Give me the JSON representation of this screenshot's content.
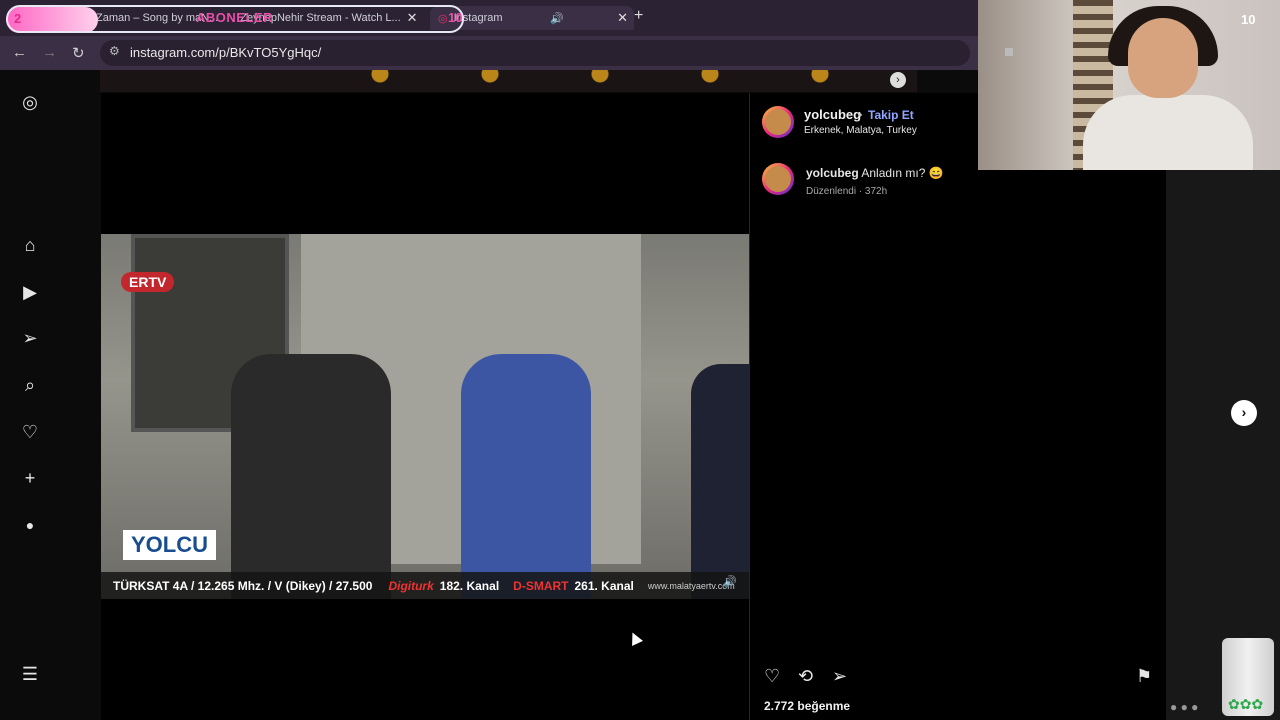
{
  "browser": {
    "tabs": [
      {
        "label": "Zaman – Song by maN..."
      },
      {
        "label": "ZeynepNehir Stream - Watch L..."
      },
      {
        "label": "Instagram"
      }
    ],
    "url": "instagram.com/p/BKvTO5YgHqc/"
  },
  "stream_overlay": {
    "counter_left": "2",
    "title": "ABONELER",
    "counter_right": "10",
    "webcam_badge": "10"
  },
  "video": {
    "logo_top": "ERTV",
    "logo_bottom": "YOLCU",
    "ticker": {
      "satellite": "TÜRKSAT 4A / 12.265 Mhz. / V (Dikey) / 27.500",
      "digiturk_brand": "Digiturk",
      "digiturk_channel": "182. Kanal",
      "dsmart_brand": "D-SMART",
      "dsmart_channel": "261. Kanal",
      "website": "www.malatyaertv.com"
    }
  },
  "post": {
    "username": "yolcubeg",
    "separator": "•",
    "follow_label": "Takip Et",
    "location": "Erkenek, Malatya, Turkey",
    "caption_user": "yolcubeg",
    "caption_text": "Anladın mı? 😄",
    "edited_label": "Düzenlendi · 372h",
    "likes": "2.772 beğenme"
  },
  "icons": {
    "sidebar": [
      "instagram-icon",
      "home-icon",
      "reels-icon",
      "direct-icon",
      "search-icon",
      "heart-icon",
      "create-icon",
      "profile-icon",
      "menu-icon"
    ],
    "actions": [
      "heart-icon",
      "repost-icon",
      "share-icon",
      "bookmark-icon"
    ]
  }
}
